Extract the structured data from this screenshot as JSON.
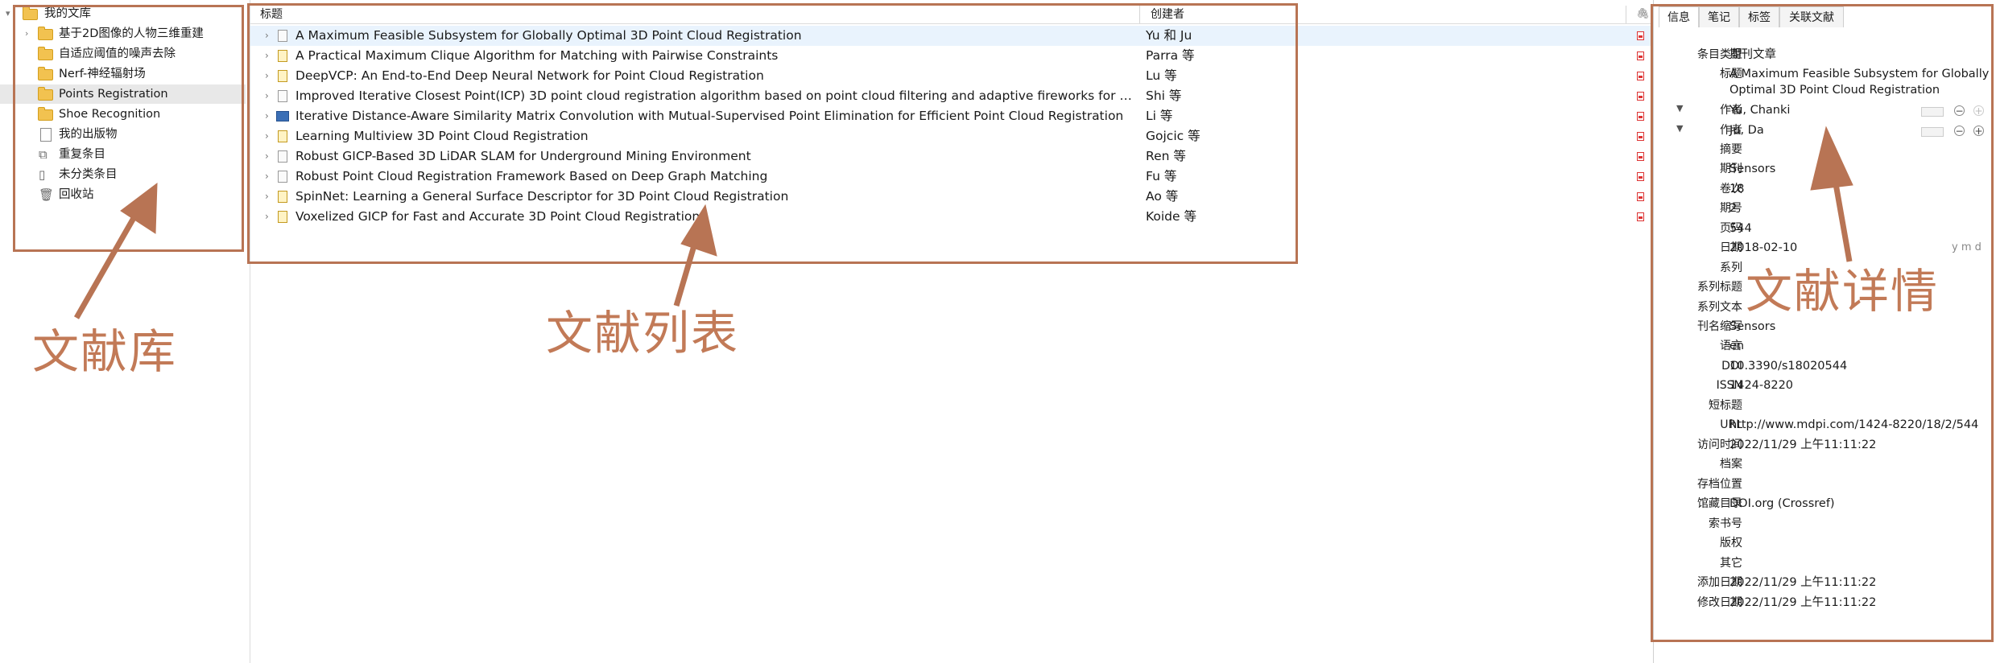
{
  "library": {
    "root": "我的文库",
    "items": [
      {
        "label": "基于2D图像的人物三维重建",
        "icon": "folder-icon",
        "expandable": true
      },
      {
        "label": "自适应阈值的噪声去除",
        "icon": "folder-icon"
      },
      {
        "label": "Nerf-神经辐射场",
        "icon": "folder-icon"
      },
      {
        "label": "Points Registration",
        "icon": "folder-icon",
        "selected": true
      },
      {
        "label": "Shoe Recognition",
        "icon": "folder-icon"
      },
      {
        "label": "我的出版物",
        "icon": "document-icon"
      },
      {
        "label": "重复条目",
        "icon": "duplicate-icon"
      },
      {
        "label": "未分类条目",
        "icon": "unfiled-icon"
      },
      {
        "label": "回收站",
        "icon": "trash-icon"
      }
    ]
  },
  "items_table": {
    "columns": {
      "title": "标题",
      "creator": "创建者",
      "attachment": "attachment-icon"
    },
    "rows": [
      {
        "title": "A Maximum Feasible Subsystem for Globally Optimal 3D Point Cloud Registration",
        "creator": "Yu 和 Ju",
        "type": "journal-article-icon",
        "selected": true
      },
      {
        "title": "A Practical Maximum Clique Algorithm for Matching with Pairwise Constraints",
        "creator": "Parra 等",
        "type": "preprint-icon"
      },
      {
        "title": "DeepVCP: An End-to-End Deep Neural Network for Point Cloud Registration",
        "creator": "Lu 等",
        "type": "conference-paper-icon"
      },
      {
        "title": "Improved Iterative Closest Point(ICP) 3D point cloud registration algorithm based on point cloud filtering and adaptive fireworks for coarse regi...",
        "creator": "Shi 等",
        "type": "journal-article-icon"
      },
      {
        "title": "Iterative Distance-Aware Similarity Matrix Convolution with Mutual-Supervised Point Elimination for Efficient Point Cloud Registration",
        "creator": "Li 等",
        "type": "book-icon"
      },
      {
        "title": "Learning Multiview 3D Point Cloud Registration",
        "creator": "Gojcic 等",
        "type": "conference-paper-icon"
      },
      {
        "title": "Robust GICP-Based 3D LiDAR SLAM for Underground Mining Environment",
        "creator": "Ren 等",
        "type": "journal-article-icon"
      },
      {
        "title": "Robust Point Cloud Registration Framework Based on Deep Graph Matching",
        "creator": "Fu 等",
        "type": "journal-article-icon"
      },
      {
        "title": "SpinNet: Learning a General Surface Descriptor for 3D Point Cloud Registration",
        "creator": "Ao 等",
        "type": "conference-paper-icon"
      },
      {
        "title": "Voxelized GICP for Fast and Accurate 3D Point Cloud Registration",
        "creator": "Koide 等",
        "type": "conference-paper-icon"
      }
    ]
  },
  "details": {
    "tabs": [
      "信息",
      "笔记",
      "标签",
      "关联文献"
    ],
    "active_tab": "信息",
    "fields": [
      {
        "label": "条目类型",
        "value": "期刊文章"
      },
      {
        "label": "标题",
        "value": "A Maximum Feasible Subsystem for Globally",
        "value2": "Optimal 3D Point Cloud Registration"
      },
      {
        "label": "作者",
        "value": "Yu, Chanki",
        "creator": true
      },
      {
        "label": "作者",
        "value": "Ju, Da",
        "creator": true
      },
      {
        "label": "摘要",
        "value": ""
      },
      {
        "label": "期刊",
        "value": "Sensors"
      },
      {
        "label": "卷次",
        "value": "18"
      },
      {
        "label": "期号",
        "value": "2"
      },
      {
        "label": "页码",
        "value": "544"
      },
      {
        "label": "日期",
        "value": "2018-02-10",
        "hint": "y m d"
      },
      {
        "label": "系列",
        "value": ""
      },
      {
        "label": "系列标题",
        "value": ""
      },
      {
        "label": "系列文本",
        "value": ""
      },
      {
        "label": "刊名缩写",
        "value": "Sensors"
      },
      {
        "label": "语言",
        "value": "en"
      },
      {
        "label": "DOI",
        "value": "10.3390/s18020544"
      },
      {
        "label": "ISSN",
        "value": "1424-8220"
      },
      {
        "label": "短标题",
        "value": ""
      },
      {
        "label": "URL",
        "value": "http://www.mdpi.com/1424-8220/18/2/544"
      },
      {
        "label": "访问时间",
        "value": "2022/11/29 上午11:11:22"
      },
      {
        "label": "档案",
        "value": ""
      },
      {
        "label": "存档位置",
        "value": ""
      },
      {
        "label": "馆藏目录",
        "value": "DOI.org (Crossref)"
      },
      {
        "label": "索书号",
        "value": ""
      },
      {
        "label": "版权",
        "value": ""
      },
      {
        "label": "其它",
        "value": ""
      },
      {
        "label": "添加日期",
        "value": "2022/11/29 上午11:11:22"
      },
      {
        "label": "修改日期",
        "value": "2022/11/29 上午11:11:22"
      }
    ]
  },
  "annotations": {
    "library": "文献库",
    "list": "文献列表",
    "details": "文献详情",
    "color": "#b87454"
  }
}
